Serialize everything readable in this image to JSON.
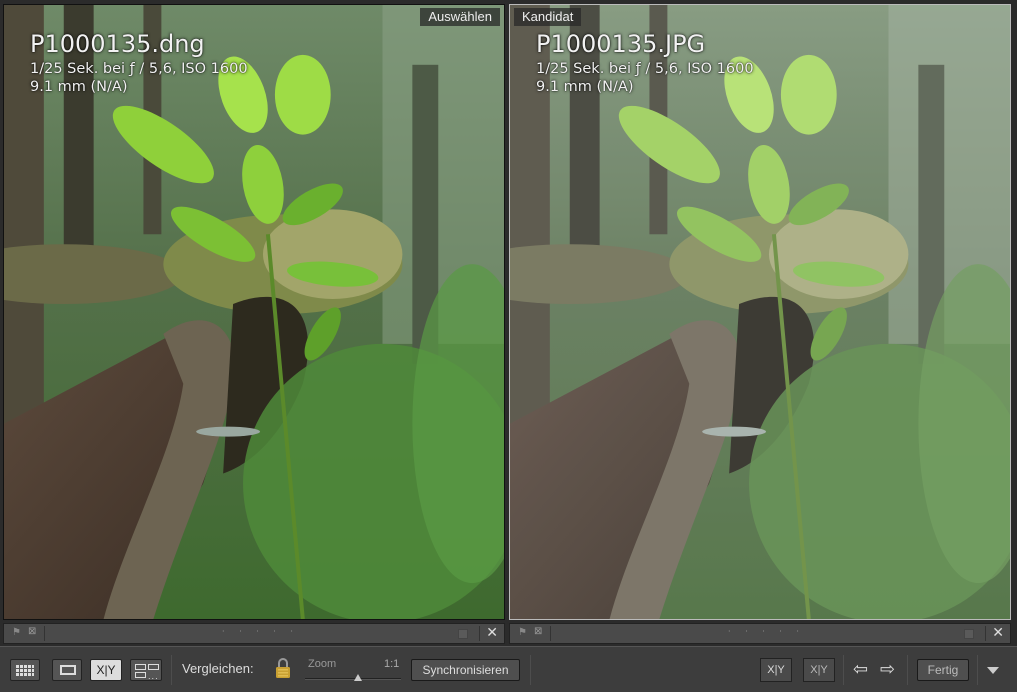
{
  "left_panel": {
    "tag": "Auswählen",
    "filename": "P1000135.dng",
    "exposure": "1/25 Sek. bei ƒ / 5,6, ISO 1600",
    "focal": "9.1 mm (N/A)"
  },
  "right_panel": {
    "tag": "Kandidat",
    "filename": "P1000135.JPG",
    "exposure": "1/25 Sek. bei ƒ / 5,6, ISO 1600",
    "focal": "9.1 mm (N/A)"
  },
  "infobar": {
    "dots": "· · · · ·",
    "close_glyph": "✕",
    "flag_glyph": "⚑",
    "reject_glyph": "⊠"
  },
  "toolbar": {
    "xy_label": "X|Y",
    "compare_label": "Vergleichen:",
    "zoom_label": "Zoom",
    "zoom_ratio": "1:1",
    "zoom_level": 0.55,
    "sync_label": "Synchronisieren",
    "swap_label": "X|Y",
    "promote_label": "X|Y",
    "prev_glyph": "⇦",
    "next_glyph": "⇨",
    "done_label": "Fertig"
  },
  "icons": {
    "grid": "grid-view-icon",
    "loupe": "loupe-view-icon",
    "compare": "compare-view-icon",
    "survey": "survey-view-icon",
    "lock": "lock-icon",
    "swap": "swap-icon",
    "promote": "make-select-icon",
    "prev": "arrow-left-icon",
    "next": "arrow-right-icon",
    "menu": "chevron-down-icon"
  },
  "colors": {
    "background": "#2b2b2b",
    "toolbar": "#3d3d3d",
    "foliage": "#5f9a3a",
    "leaf_bright": "#a8e04a"
  }
}
